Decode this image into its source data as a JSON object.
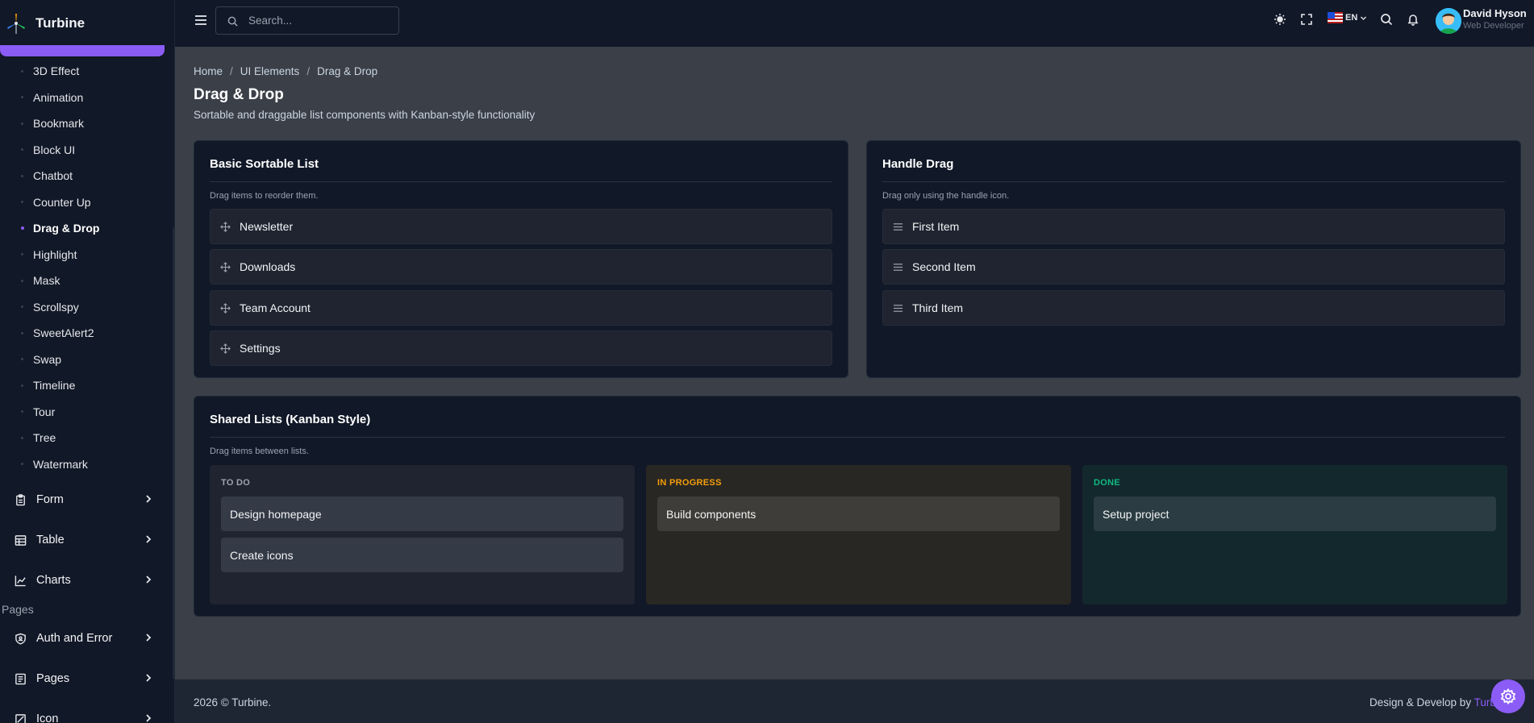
{
  "brand": {
    "name": "Turbine"
  },
  "sidebar": {
    "sub_items": [
      {
        "label": "3D Effect"
      },
      {
        "label": "Animation"
      },
      {
        "label": "Bookmark"
      },
      {
        "label": "Block UI"
      },
      {
        "label": "Chatbot"
      },
      {
        "label": "Counter Up"
      },
      {
        "label": "Drag & Drop",
        "active": true
      },
      {
        "label": "Highlight"
      },
      {
        "label": "Mask"
      },
      {
        "label": "Scrollspy"
      },
      {
        "label": "SweetAlert2"
      },
      {
        "label": "Swap"
      },
      {
        "label": "Timeline"
      },
      {
        "label": "Tour"
      },
      {
        "label": "Tree"
      },
      {
        "label": "Watermark"
      }
    ],
    "groups": [
      {
        "label": "Form",
        "icon": "clipboard-icon"
      },
      {
        "label": "Table",
        "icon": "table-icon"
      },
      {
        "label": "Charts",
        "icon": "chart-line-icon"
      }
    ],
    "pages_heading": "Pages",
    "page_groups": [
      {
        "label": "Auth and Error",
        "icon": "shield-icon"
      },
      {
        "label": "Pages",
        "icon": "file-icon"
      },
      {
        "label": "Icon",
        "icon": "icon-icon"
      }
    ]
  },
  "topbar": {
    "search_placeholder": "Search...",
    "language": "EN",
    "user_name": "David Hyson",
    "user_role": "Web Developer"
  },
  "breadcrumb": {
    "home": "Home",
    "section": "UI Elements",
    "current": "Drag & Drop"
  },
  "page": {
    "title": "Drag & Drop",
    "subtitle": "Sortable and draggable list components with Kanban-style functionality"
  },
  "basic_list": {
    "title": "Basic Sortable List",
    "hint": "Drag items to reorder them.",
    "items": [
      "Newsletter",
      "Downloads",
      "Team Account",
      "Settings"
    ]
  },
  "handle_list": {
    "title": "Handle Drag",
    "hint": "Drag only using the handle icon.",
    "items": [
      "First Item",
      "Second Item",
      "Third Item"
    ]
  },
  "kanban": {
    "title": "Shared Lists (Kanban Style)",
    "hint": "Drag items between lists.",
    "columns": [
      {
        "title": "TO DO",
        "color": "#9ca3af",
        "items": [
          "Design homepage",
          "Create icons"
        ]
      },
      {
        "title": "IN PROGRESS",
        "color": "#f59e0b",
        "items": [
          "Build components"
        ]
      },
      {
        "title": "DONE",
        "color": "#10b981",
        "items": [
          "Setup project"
        ]
      }
    ]
  },
  "footer": {
    "left": "2026 © Turbine.",
    "right_prefix": "Design & Develop by",
    "right_brand": "Turbine"
  },
  "colors": {
    "accent": "#8b5cf6"
  }
}
